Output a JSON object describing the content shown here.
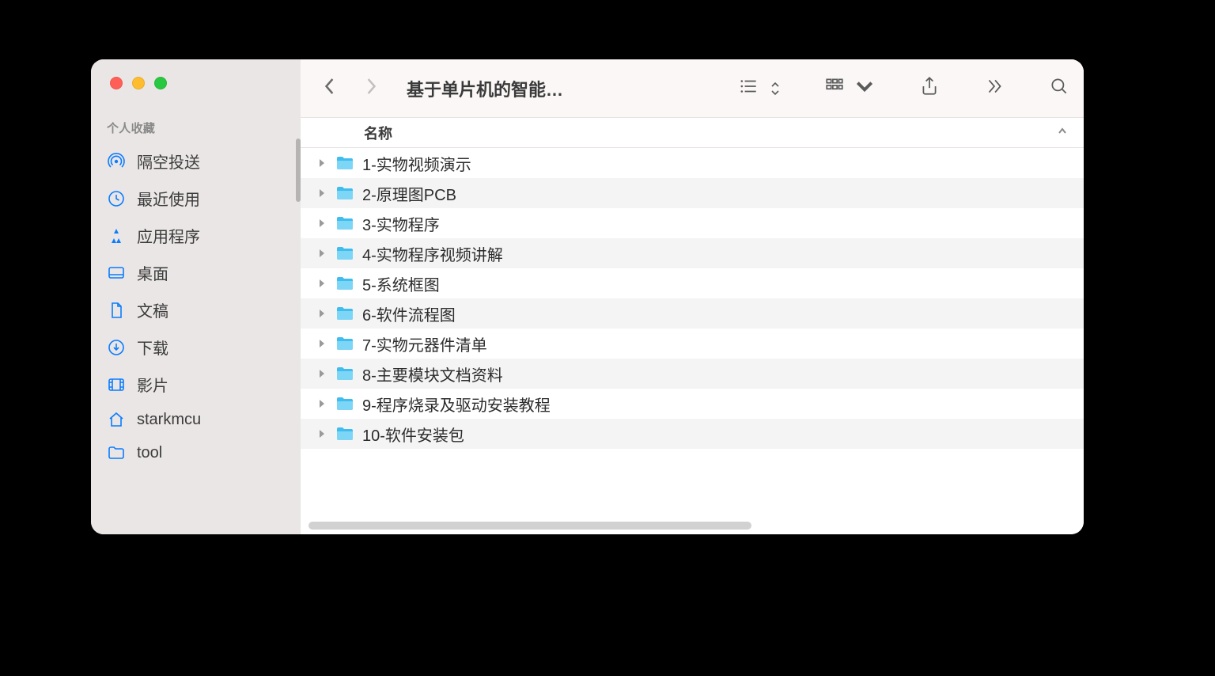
{
  "sidebar": {
    "section_heading": "个人收藏",
    "items": [
      {
        "label": "隔空投送"
      },
      {
        "label": "最近使用"
      },
      {
        "label": "应用程序"
      },
      {
        "label": "桌面"
      },
      {
        "label": "文稿"
      },
      {
        "label": "下载"
      },
      {
        "label": "影片"
      },
      {
        "label": "starkmcu"
      },
      {
        "label": "tool"
      }
    ]
  },
  "toolbar": {
    "title": "基于单片机的智能…"
  },
  "columns": {
    "name": "名称"
  },
  "files": [
    {
      "name": "1-实物视频演示"
    },
    {
      "name": "2-原理图PCB"
    },
    {
      "name": "3-实物程序"
    },
    {
      "name": "4-实物程序视频讲解"
    },
    {
      "name": "5-系统框图"
    },
    {
      "name": "6-软件流程图"
    },
    {
      "name": "7-实物元器件清单"
    },
    {
      "name": "8-主要模块文档资料"
    },
    {
      "name": "9-程序烧录及驱动安装教程"
    },
    {
      "name": "10-软件安装包"
    }
  ],
  "colors": {
    "folder_light": "#7ed6f7",
    "folder_dark": "#3fbdee"
  }
}
